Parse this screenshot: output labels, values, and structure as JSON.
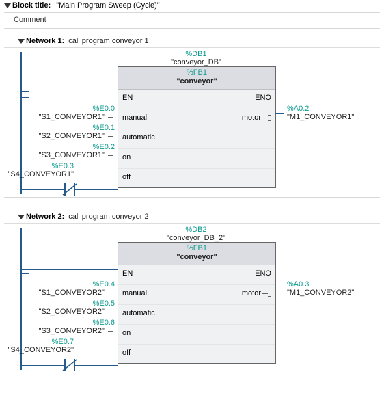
{
  "block_title_label": "Block title:",
  "block_title_value": "\"Main Program Sweep (Cycle)\"",
  "comment_placeholder": "Comment",
  "fb": {
    "fb_addr": "%FB1",
    "fb_name": "\"conveyor\"",
    "pin_en": "EN",
    "pin_eno": "ENO",
    "pin_manual": "manual",
    "pin_automatic": "automatic",
    "pin_on": "on",
    "pin_off": "off",
    "pin_motor": "motor"
  },
  "networks": [
    {
      "label": "Network 1:",
      "title": "call program conveyor 1",
      "db_addr": "%DB1",
      "db_name": "\"conveyor_DB\"",
      "inputs": [
        {
          "addr": "%E0.0",
          "sym": "\"S1_CONVEYOR1\"",
          "pin": "manual"
        },
        {
          "addr": "%E0.1",
          "sym": "\"S2_CONVEYOR1\"",
          "pin": "automatic"
        },
        {
          "addr": "%E0.2",
          "sym": "\"S3_CONVEYOR1\"",
          "pin": "on"
        },
        {
          "addr": "%E0.3",
          "sym": "\"S4_CONVEYOR1\"",
          "pin": "off"
        }
      ],
      "output": {
        "addr": "%A0.2",
        "sym": "\"M1_CONVEYOR1\"",
        "pin": "motor"
      }
    },
    {
      "label": "Network 2:",
      "title": "call program conveyor 2",
      "db_addr": "%DB2",
      "db_name": "\"conveyor_DB_2\"",
      "inputs": [
        {
          "addr": "%E0.4",
          "sym": "\"S1_CONVEYOR2\"",
          "pin": "manual"
        },
        {
          "addr": "%E0.5",
          "sym": "\"S2_CONVEYOR2\"",
          "pin": "automatic"
        },
        {
          "addr": "%E0.6",
          "sym": "\"S3_CONVEYOR2\"",
          "pin": "on"
        },
        {
          "addr": "%E0.7",
          "sym": "\"S4_CONVEYOR2\"",
          "pin": "off"
        }
      ],
      "output": {
        "addr": "%A0.3",
        "sym": "\"M1_CONVEYOR2\"",
        "pin": "motor"
      }
    }
  ]
}
